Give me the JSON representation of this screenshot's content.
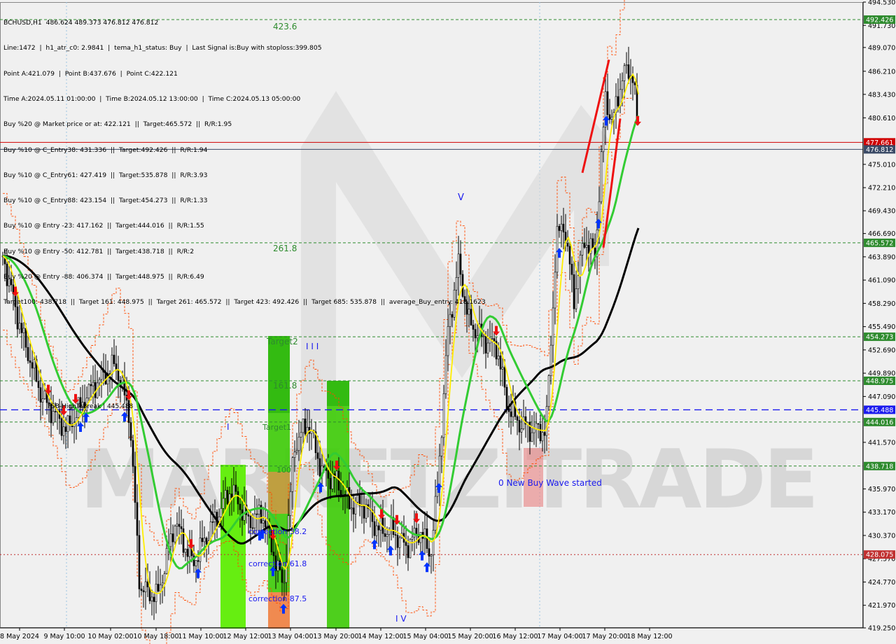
{
  "info_panel": {
    "lines": [
      "BCHUSD,H1  486.624 489.373 476.812 476.812",
      "Line:1472  |  h1_atr_c0: 2.9841  |  tema_h1_status: Buy  |  Last Signal is:Buy with stoploss:399.805",
      "Point A:421.079  |  Point B:437.676  |  Point C:422.121",
      "Time A:2024.05.11 01:00:00  |  Time B:2024.05.12 13:00:00  |  Time C:2024.05.13 05:00:00",
      "Buy %20 @ Market price or at: 422.121  ||  Target:465.572  ||  R/R:1.95",
      "Buy %10 @ C_Entry38: 431.336  ||  Target:492.426  ||  R/R:1.94",
      "Buy %10 @ C_Entry61: 427.419  ||  Target:535.878  ||  R/R:3.93",
      "Buy %10 @ C_Entry88: 423.154  ||  Target:454.273  ||  R/R:1.33",
      "Buy %10 @ Entry -23: 417.162  ||  Target:444.016  ||  R/R:1.55",
      "Buy %10 @ Entry -50: 412.781  ||  Target:438.718  ||  R/R:2",
      "Buy %20 @ Entry -88: 406.374  ||  Target:448.975  ||  R/R:6.49",
      "Target100: 438.718  ||  Target 161: 448.975  ||  Target 261: 465.572  ||  Target 423: 492.426  ||  Target 685: 535.878  ||  average_Buy_entry: 418.1623"
    ]
  },
  "chart_data": {
    "type": "candlestick",
    "symbol": "BCHUSD",
    "timeframe": "H1",
    "ylim": [
      419.25,
      494.53
    ],
    "y_ticks": [
      "494.530",
      "491.730",
      "489.070",
      "486.210",
      "483.430",
      "480.610",
      "477.661",
      "476.812",
      "475.010",
      "472.210",
      "469.430",
      "466.690",
      "465.572",
      "463.890",
      "461.090",
      "458.290",
      "455.490",
      "454.273",
      "452.690",
      "449.890",
      "448.975",
      "447.090",
      "445.488",
      "444.016",
      "441.570",
      "438.718",
      "435.970",
      "433.170",
      "430.370",
      "428.075",
      "427.570",
      "424.770",
      "421.970",
      "419.250"
    ],
    "x_tick_labels": [
      "8 May 2024",
      "9 May 10:00",
      "10 May 02:00",
      "10 May 18:00",
      "11 May 10:00",
      "12 May 12:00",
      "13 May 04:00",
      "13 May 20:00",
      "14 May 12:00",
      "15 May 04:00",
      "15 May 20:00",
      "16 May 12:00",
      "17 May 04:00",
      "17 May 20:00",
      "18 May 12:00"
    ],
    "last_price": 476.812,
    "levels": [
      {
        "value": 492.426,
        "label": "492.426",
        "color": "#2e8b2e",
        "style": "dashed"
      },
      {
        "value": 477.661,
        "label": "477.661",
        "color": "#d00000",
        "style": "solid"
      },
      {
        "value": 476.812,
        "label": "476.812",
        "color": "#3a4a66",
        "style": "solid"
      },
      {
        "value": 465.572,
        "label": "465.572",
        "color": "#2e8b2e",
        "style": "dashed"
      },
      {
        "value": 454.273,
        "label": "454.273",
        "color": "#2e8b2e",
        "style": "dashed"
      },
      {
        "value": 448.975,
        "label": "448.975",
        "color": "#2e8b2e",
        "style": "dashed"
      },
      {
        "value": 445.488,
        "label": "445.488",
        "color": "#1a1aee",
        "style": "dashed"
      },
      {
        "value": 444.016,
        "label": "444.016",
        "color": "#2e8b2e",
        "style": "dashed"
      },
      {
        "value": 438.718,
        "label": "438.718",
        "color": "#2e8b2e",
        "style": "dashed"
      },
      {
        "value": 428.075,
        "label": "428.075",
        "color": "#c03030",
        "style": "dotted"
      }
    ],
    "annotations": [
      {
        "text": "423.6",
        "color": "#2e8b2e"
      },
      {
        "text": "261.8",
        "color": "#2e8b2e"
      },
      {
        "text": "Target2",
        "color": "#2e8b2e"
      },
      {
        "text": "161.8",
        "color": "#2e8b2e"
      },
      {
        "text": "Target1",
        "color": "#2e8b2e"
      },
      {
        "text": "100",
        "color": "#2e8b2e"
      },
      {
        "text": "I I I",
        "color": "#1a1aee"
      },
      {
        "text": "I",
        "color": "#1a1aee"
      },
      {
        "text": "V",
        "color": "#1a1aee"
      },
      {
        "text": "I V",
        "color": "#1a1aee"
      },
      {
        "text": "FSB-HighToBreak | 445.488",
        "color": "#000000"
      },
      {
        "text": "correction 38.2",
        "color": "#1a1aee"
      },
      {
        "text": "correction 61.8",
        "color": "#1a1aee"
      },
      {
        "text": "correction 87.5",
        "color": "#1a1aee"
      },
      {
        "text": "0 New Buy Wave started",
        "color": "#1a1aee"
      }
    ],
    "watermark": "MARKETZITRADE",
    "colors": {
      "background": "#f0f0f0",
      "candle": "#000000",
      "ma_fast": "#ffee00",
      "ma_mid": "#33cc33",
      "ma_slow": "#000000",
      "channel": "#ff4a00",
      "target_zone": "#44cc11",
      "entry_zone": "#f08a50",
      "buy_arrow": "#0033ff",
      "sell_arrow": "#ee1111"
    }
  }
}
